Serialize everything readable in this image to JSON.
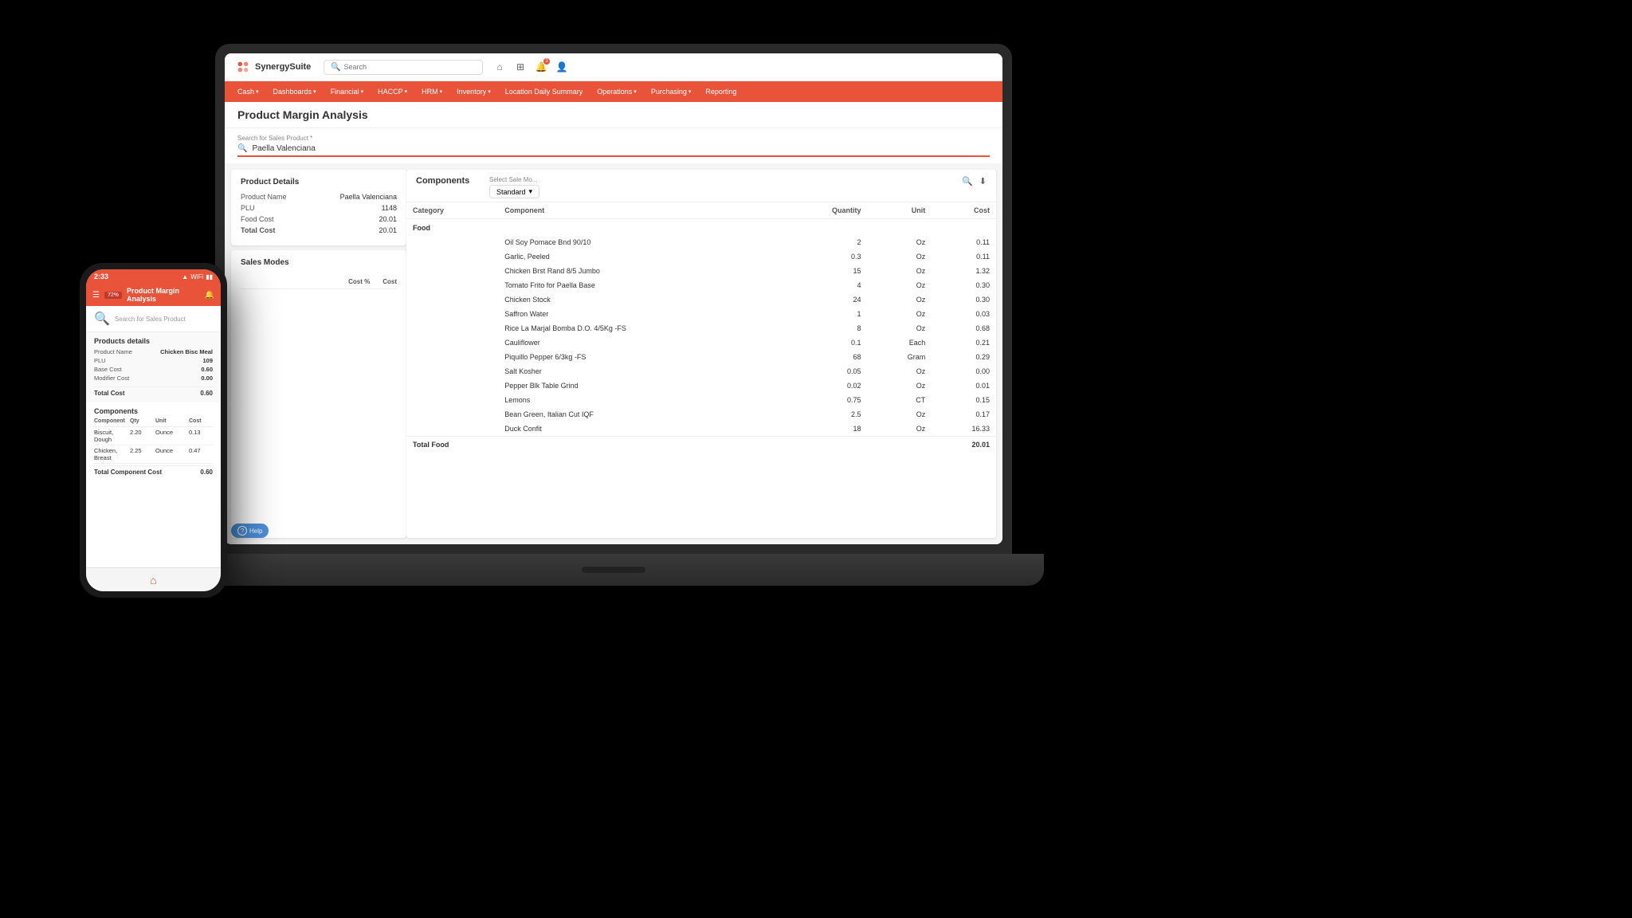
{
  "app": {
    "name": "SynergySuite",
    "page_title": "Product Margin Analysis"
  },
  "header": {
    "search_placeholder": "Search",
    "home_icon": "⌂",
    "grid_icon": "⊞",
    "notif_icon": "🔔",
    "notif_count": "3",
    "user_icon": "👤"
  },
  "nav": {
    "items": [
      {
        "label": "Cash",
        "has_chevron": true
      },
      {
        "label": "Dashboards",
        "has_chevron": true
      },
      {
        "label": "Financial",
        "has_chevron": true
      },
      {
        "label": "HACCP",
        "has_chevron": true
      },
      {
        "label": "HRM",
        "has_chevron": true
      },
      {
        "label": "Inventory",
        "has_chevron": true
      },
      {
        "label": "Location Daily Summary",
        "has_chevron": false
      },
      {
        "label": "Operations",
        "has_chevron": true
      },
      {
        "label": "Purchasing",
        "has_chevron": true
      },
      {
        "label": "Reporting",
        "has_chevron": false
      }
    ]
  },
  "search_product": {
    "label": "Search for Sales Product *",
    "value": "Paella Valenciana"
  },
  "product_details": {
    "title": "Product Details",
    "rows": [
      {
        "label": "Product Name",
        "value": "Paella Valenciana"
      },
      {
        "label": "PLU",
        "value": "1148"
      },
      {
        "label": "Food Cost",
        "value": "20.01"
      },
      {
        "label": "Total Cost",
        "value": "20.01"
      }
    ]
  },
  "sales_modes": {
    "title": "Sales Modes",
    "columns": [
      "Cost %",
      "Cost"
    ]
  },
  "components": {
    "label": "Components",
    "sale_mode_label": "Select Sale Mo...",
    "sale_mode_value": "Standard",
    "columns": [
      "Category",
      "Component",
      "Quantity",
      "Unit",
      "Cost"
    ],
    "category": "Food",
    "rows": [
      {
        "component": "Oil Soy Pomace Bnd 90/10",
        "quantity": "2",
        "unit": "Oz",
        "cost": "0.11"
      },
      {
        "component": "Garlic, Peeled",
        "quantity": "0.3",
        "unit": "Oz",
        "cost": "0.11"
      },
      {
        "component": "Chicken Brst Rand 8/5 Jumbo",
        "quantity": "15",
        "unit": "Oz",
        "cost": "1.32"
      },
      {
        "component": "Tomato Frito for Paella Base",
        "quantity": "4",
        "unit": "Oz",
        "cost": "0.30"
      },
      {
        "component": "Chicken Stock",
        "quantity": "24",
        "unit": "Oz",
        "cost": "0.30"
      },
      {
        "component": "Saffron Water",
        "quantity": "1",
        "unit": "Oz",
        "cost": "0.03"
      },
      {
        "component": "Rice La Marjal Bomba D.O. 4/5Kg -FS",
        "quantity": "8",
        "unit": "Oz",
        "cost": "0.68"
      },
      {
        "component": "Cauliflower",
        "quantity": "0.1",
        "unit": "Each",
        "cost": "0.21"
      },
      {
        "component": "Piquillo Pepper 6/3kg -FS",
        "quantity": "68",
        "unit": "Gram",
        "cost": "0.29"
      },
      {
        "component": "Salt Kosher",
        "quantity": "0.05",
        "unit": "Oz",
        "cost": "0.00"
      },
      {
        "component": "Pepper Blk Table Grind",
        "quantity": "0.02",
        "unit": "Oz",
        "cost": "0.01"
      },
      {
        "component": "Lemons",
        "quantity": "0.75",
        "unit": "CT",
        "cost": "0.15"
      },
      {
        "component": "Bean Green, Italian Cut IQF",
        "quantity": "2.5",
        "unit": "Oz",
        "cost": "0.17"
      },
      {
        "component": "Duck Confit",
        "quantity": "18",
        "unit": "Oz",
        "cost": "16.33"
      }
    ],
    "total_food_label": "Total Food",
    "total_food_value": "20.01"
  },
  "help_button": {
    "label": "Help",
    "icon": "?"
  },
  "phone": {
    "time": "2:33",
    "status_icons": [
      "▲",
      "WiFi",
      "Bat"
    ],
    "app_badge": "72%",
    "page_title": "Product Margin Analysis",
    "search_placeholder": "Search for Sales Product",
    "products_details_title": "Products details",
    "product": {
      "name_label": "Product Name",
      "name_value": "Chicken Bisc Meal",
      "plu_label": "PLU",
      "plu_value": "109",
      "base_cost_label": "Base Cost",
      "base_cost_value": "0.60",
      "modifier_cost_label": "Modifier Cost",
      "modifier_cost_value": "0.00",
      "total_cost_label": "Total Cost",
      "total_cost_value": "0.60"
    },
    "components_title": "Components",
    "comp_columns": [
      "Component",
      "Qty",
      "Unit",
      "Cost"
    ],
    "comp_rows": [
      {
        "component": "Biscuit, Dough",
        "qty": "2.20",
        "unit": "Ounce",
        "cost": "0.13"
      },
      {
        "component": "Chicken, Breast",
        "qty": "2.25",
        "unit": "Ounce",
        "cost": "0.47"
      }
    ],
    "comp_total_label": "Total Component Cost",
    "comp_total_value": "0.60"
  }
}
